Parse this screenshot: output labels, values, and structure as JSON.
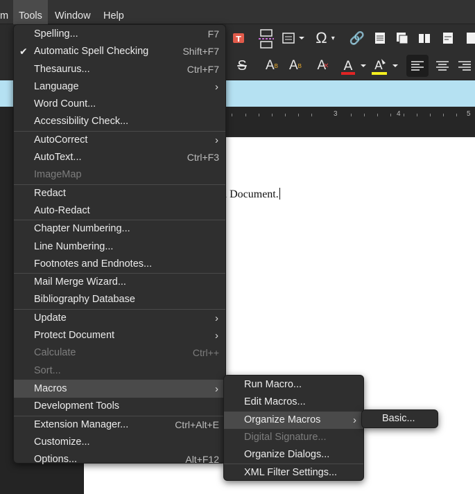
{
  "menubar": {
    "items": [
      {
        "label": "m",
        "active": false
      },
      {
        "label": "Tools",
        "active": true
      },
      {
        "label": "Window",
        "active": false
      },
      {
        "label": "Help",
        "active": false
      }
    ]
  },
  "ruler": {
    "numbers": [
      "3",
      "4",
      "5"
    ]
  },
  "document": {
    "text": "en Document."
  },
  "tools_menu": {
    "groups": [
      [
        {
          "label": "Spelling...",
          "shortcut": "F7"
        },
        {
          "label": "Automatic Spell Checking",
          "shortcut": "Shift+F7",
          "checked": true
        },
        {
          "label": "Thesaurus...",
          "shortcut": "Ctrl+F7"
        },
        {
          "label": "Language",
          "submenu": true
        },
        {
          "label": "Word Count..."
        },
        {
          "label": "Accessibility Check..."
        }
      ],
      [
        {
          "label": "AutoCorrect",
          "submenu": true
        },
        {
          "label": "AutoText...",
          "shortcut": "Ctrl+F3"
        },
        {
          "label": "ImageMap",
          "disabled": true
        }
      ],
      [
        {
          "label": "Redact"
        },
        {
          "label": "Auto-Redact"
        }
      ],
      [
        {
          "label": "Chapter Numbering..."
        },
        {
          "label": "Line Numbering..."
        },
        {
          "label": "Footnotes and Endnotes..."
        }
      ],
      [
        {
          "label": "Mail Merge Wizard..."
        },
        {
          "label": "Bibliography Database"
        }
      ],
      [
        {
          "label": "Update",
          "submenu": true
        },
        {
          "label": "Protect Document",
          "submenu": true
        },
        {
          "label": "Calculate",
          "shortcut": "Ctrl++",
          "disabled": true
        },
        {
          "label": "Sort...",
          "disabled": true
        }
      ],
      [
        {
          "label": "Macros",
          "submenu": true,
          "highlighted": true
        },
        {
          "label": "Development Tools"
        }
      ],
      [
        {
          "label": "Extension Manager...",
          "shortcut": "Ctrl+Alt+E"
        },
        {
          "label": "Customize..."
        },
        {
          "label": "Options...",
          "shortcut": "Alt+F12"
        }
      ]
    ]
  },
  "macros_menu": {
    "groups": [
      [
        {
          "label": "Run Macro..."
        },
        {
          "label": "Edit Macros..."
        },
        {
          "label": "Organize Macros",
          "submenu": true,
          "highlighted": true
        },
        {
          "label": "Digital Signature...",
          "disabled": true
        },
        {
          "label": "Organize Dialogs..."
        }
      ],
      [
        {
          "label": "XML Filter Settings..."
        }
      ]
    ]
  },
  "organize_menu": {
    "groups": [
      [
        {
          "label": "Basic..."
        }
      ]
    ]
  },
  "icons": {
    "arrow": "›",
    "check": "✔"
  }
}
